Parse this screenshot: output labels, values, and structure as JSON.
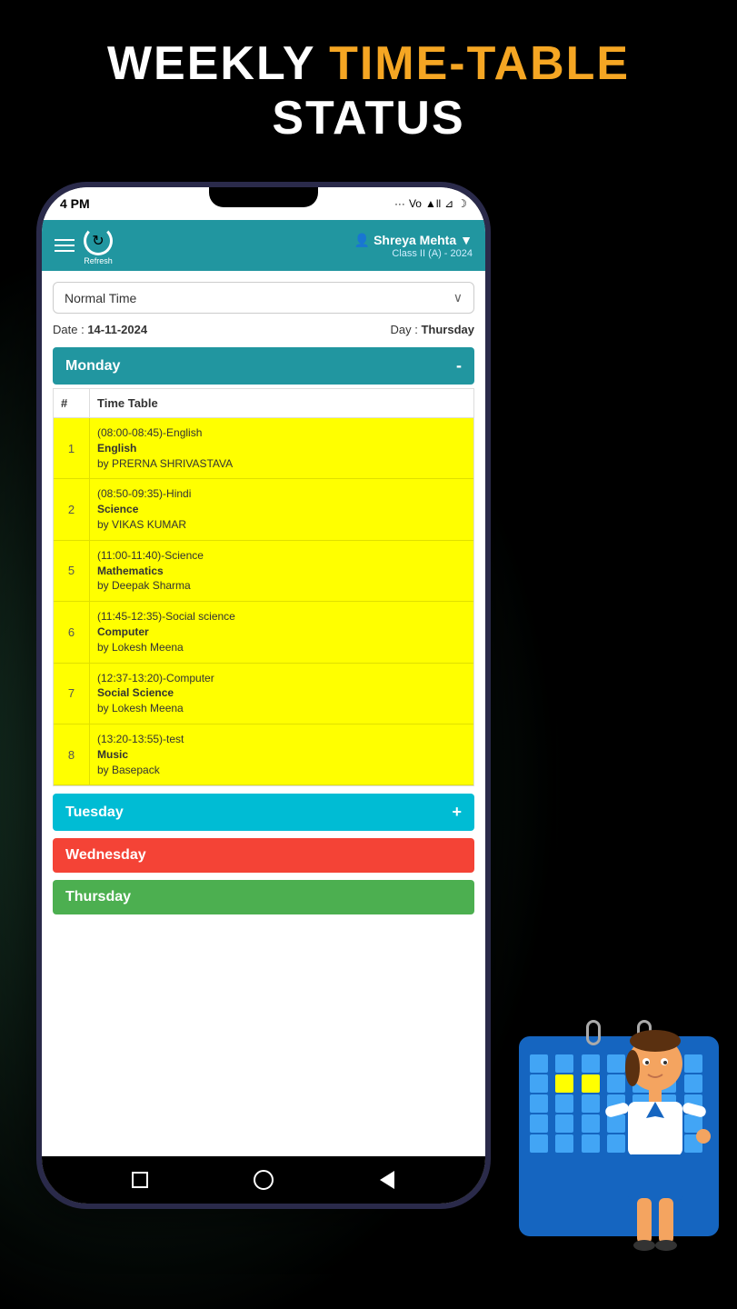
{
  "page": {
    "title_part1": "WEEKLY",
    "title_part2": "TIME-TABLE",
    "title_part3": "STATUS"
  },
  "statusBar": {
    "time": "4 PM",
    "icons": "... Vo⊿ll ▲ ☽"
  },
  "topNav": {
    "refreshLabel": "Refresh",
    "userName": "Shreya Mehta",
    "classInfo": "Class II (A) - 2024"
  },
  "dropdown": {
    "selected": "Normal Time",
    "placeholder": "Normal Time"
  },
  "dateInfo": {
    "dateLabel": "Date :",
    "dateValue": "14-11-2024",
    "dayLabel": "Day :",
    "dayValue": "Thursday"
  },
  "monday": {
    "label": "Monday",
    "isOpen": true,
    "toggleIcon": "-",
    "columns": [
      "#",
      "Time Table"
    ],
    "rows": [
      {
        "num": "1",
        "text": "(08:00-08:45)-English",
        "bold": "English",
        "suffix": " by PRERNA SHRIVASTAVA"
      },
      {
        "num": "2",
        "text": "(08:50-09:35)-Hindi",
        "bold": "Science",
        "suffix": " by VIKAS KUMAR"
      },
      {
        "num": "5",
        "text": "(11:00-11:40)-Science",
        "bold": "Mathematics",
        "suffix": " by Deepak Sharma"
      },
      {
        "num": "6",
        "text": "(11:45-12:35)-Social science",
        "bold": "Computer",
        "suffix": " by Lokesh Meena"
      },
      {
        "num": "7",
        "text": "(12:37-13:20)-Computer",
        "bold": "Social Science",
        "suffix": " by Lokesh Meena"
      },
      {
        "num": "8",
        "text": "(13:20-13:55)-test",
        "bold": "Music",
        "suffix": " by Basepack"
      }
    ]
  },
  "tuesday": {
    "label": "Tuesday",
    "isOpen": false,
    "toggleIcon": "+"
  },
  "wednesday": {
    "label": "Wednesday",
    "isOpen": false,
    "toggleIcon": ""
  },
  "thursday": {
    "label": "Thursday",
    "isOpen": false,
    "toggleIcon": ""
  },
  "bottomNav": {
    "items": [
      "square",
      "circle",
      "triangle"
    ]
  }
}
